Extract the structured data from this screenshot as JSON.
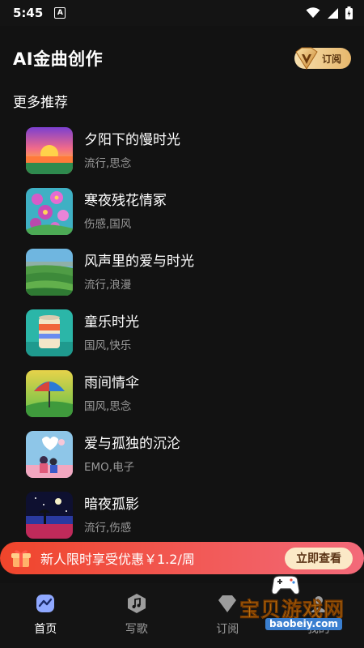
{
  "status_bar": {
    "time": "5:45",
    "notification_icon": "a-icon"
  },
  "header": {
    "title": "AI金曲创作",
    "subscribe_label": "订阅"
  },
  "section": {
    "title": "更多推荐"
  },
  "songs": [
    {
      "title": "夕阳下的慢时光",
      "tags": "流行,思念",
      "cover": "sunset-cover"
    },
    {
      "title": "寒夜残花情冢",
      "tags": "伤感,国风",
      "cover": "flowers-cover"
    },
    {
      "title": "风声里的爱与时光",
      "tags": "流行,浪漫",
      "cover": "terraces-cover"
    },
    {
      "title": "童乐时光",
      "tags": "国风,快乐",
      "cover": "can-cover"
    },
    {
      "title": "雨间情伞",
      "tags": "国风,思念",
      "cover": "umbrella-cover"
    },
    {
      "title": "爱与孤独的沉沦",
      "tags": "EMO,电子",
      "cover": "couple-cover"
    },
    {
      "title": "暗夜孤影",
      "tags": "流行,伤感",
      "cover": "night-cover"
    }
  ],
  "promo": {
    "text": "新人限时享受优惠￥1.2/周",
    "button_label": "立即查看"
  },
  "nav": [
    {
      "label": "首页",
      "icon": "home-icon",
      "active": true
    },
    {
      "label": "写歌",
      "icon": "music-note-icon",
      "active": false
    },
    {
      "label": "订阅",
      "icon": "diamond-icon",
      "active": false
    },
    {
      "label": "我的",
      "icon": "profile-icon",
      "active": false
    }
  ],
  "watermark": {
    "text": "宝贝游戏网",
    "url": "baobeiy.com"
  },
  "colors": {
    "background": "#121212",
    "promo_start": "#f0452b",
    "promo_end": "#f36a7a",
    "gold": "#e7b76c"
  }
}
